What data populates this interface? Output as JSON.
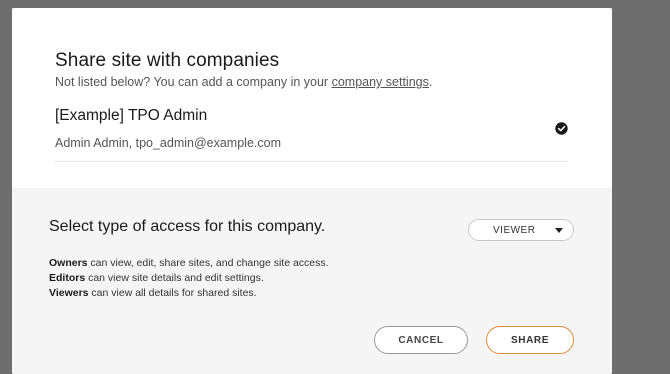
{
  "dialog": {
    "title": "Share site with companies",
    "subtitle_prefix": "Not listed below? You can add a company in your ",
    "subtitle_link": "company settings",
    "subtitle_suffix": "."
  },
  "company": {
    "name": "[Example] TPO Admin",
    "contact": "Admin Admin, tpo_admin@example.com",
    "selected": true
  },
  "access": {
    "title": "Select type of access for this company.",
    "roles": [
      {
        "role": "Owners",
        "desc": " can view, edit, share sites, and change site access."
      },
      {
        "role": "Editors",
        "desc": " can view site details and edit settings."
      },
      {
        "role": "Viewers",
        "desc": " can view all details for shared sites."
      }
    ],
    "selected_option": "VIEWER"
  },
  "actions": {
    "cancel_label": "CANCEL",
    "share_label": "SHARE"
  },
  "colors": {
    "share_border": "#e08a3a",
    "backdrop": "#6e6e6e"
  },
  "icons": {
    "close": "close-icon",
    "check": "check-circle-icon",
    "caret": "caret-down-icon"
  }
}
